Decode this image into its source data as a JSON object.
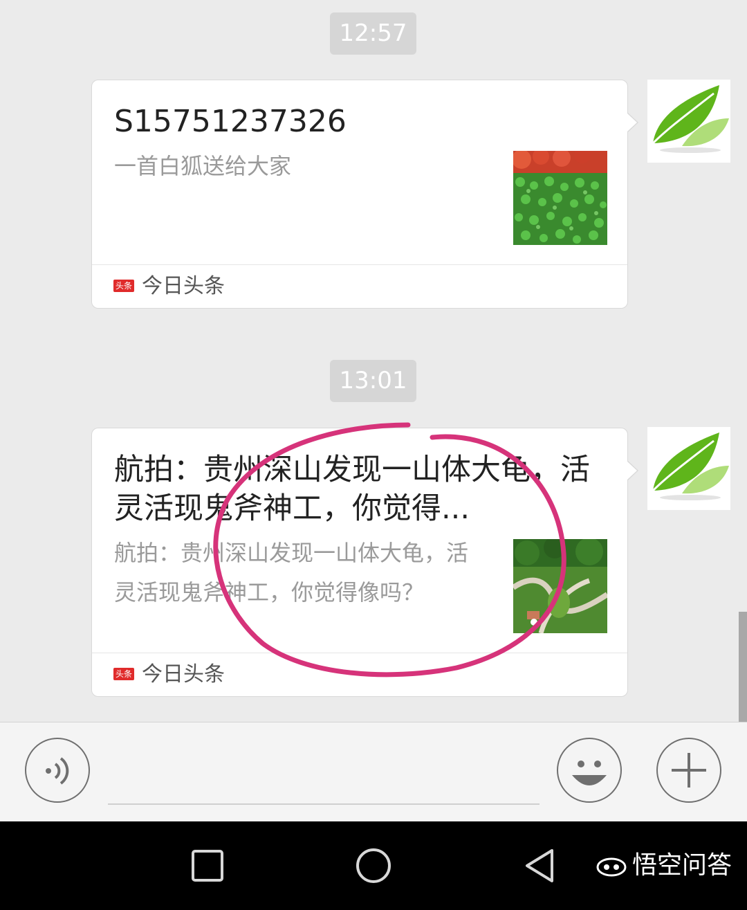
{
  "messages": [
    {
      "time": "12:57",
      "title": "S15751237326",
      "description": "一首白狐送给大家",
      "source": "今日头条",
      "source_logo_text": "头条"
    },
    {
      "time": "13:01",
      "title": "航拍：贵州深山发现一山体大龟，活灵活现鬼斧神工，你觉得...",
      "description": "航拍：贵州深山发现一山体大龟，活灵活现鬼斧神工，你觉得像吗？",
      "source": "今日头条",
      "source_logo_text": "头条"
    }
  ],
  "input_bar": {
    "voice_icon": "voice-icon",
    "emoji_icon": "smiley-icon",
    "plus_icon": "plus-icon"
  },
  "nav": {
    "recents_icon": "square-icon",
    "home_icon": "circle-icon",
    "back_icon": "back-triangle-icon"
  },
  "watermark": {
    "text": "悟空问答"
  },
  "colors": {
    "background": "#ebebeb",
    "annotation_circle": "#d6337a",
    "source_logo": "#e02b2b",
    "avatar_leaf": "#6cc120"
  }
}
